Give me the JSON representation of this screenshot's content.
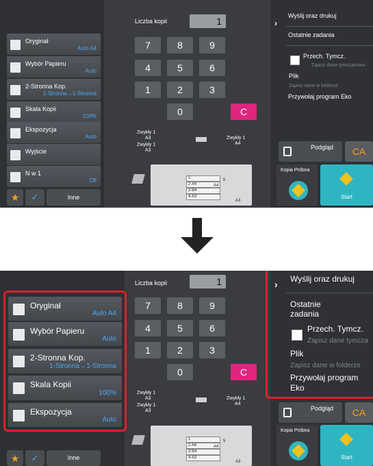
{
  "top_panel": {
    "menu": [
      {
        "label": "Oryginał",
        "value": "Auto A4",
        "icon": "original-icon"
      },
      {
        "label": "Wybór Papieru",
        "value": "Auto",
        "icon": "paper-select-icon"
      },
      {
        "label": "2-Stronna Kop.",
        "value": "1-Stronna→1-Stronna",
        "icon": "duplex-icon"
      },
      {
        "label": "Skala Kopii",
        "value": "100%",
        "icon": "scale-icon"
      },
      {
        "label": "Ekspozycja",
        "value": "Auto",
        "icon": "exposure-icon"
      },
      {
        "label": "Wyjście",
        "value": "",
        "icon": "output-icon"
      },
      {
        "label": "N w 1",
        "value": "Off",
        "icon": "n-in-1-icon"
      }
    ],
    "toolbar": {
      "others_label": "Inne"
    },
    "keypad": {
      "copies_label": "Liczba kopii",
      "copies_value": "1",
      "keys": [
        "7",
        "8",
        "9",
        "4",
        "5",
        "6",
        "1",
        "2",
        "3",
        "0"
      ],
      "clear_label": "C"
    },
    "trays": {
      "tray1": {
        "name": "Zwykły 1",
        "size": "A3"
      },
      "tray2": {
        "name": "Zwykły 1",
        "size": "A3"
      },
      "tray3": {
        "name": "Zwykły 1",
        "size": "A4"
      }
    },
    "copier_trays": [
      {
        "num": "1",
        "size": ""
      },
      {
        "num": "2",
        "size": "A4"
      },
      {
        "num": "3",
        "size": "B4"
      },
      {
        "num": "4",
        "size": "A3"
      }
    ],
    "copier_side": [
      {
        "label": "A4"
      },
      {
        "label": "5"
      },
      {
        "label": "A3"
      }
    ],
    "right": {
      "send_print": "Wyślij oraz drukuj",
      "recent_jobs": "Ostatnie zadania",
      "temp_save": "Przech. Tymcz.",
      "temp_save_sub": "Zapisz dane tymczasowo",
      "file": "Plik",
      "file_sub": "Zapisz dane w folderze",
      "eco": "Przywołaj program Eko",
      "preview": "Podgląd",
      "ca": "CA",
      "proof": "Kopia Próbna",
      "start": "Start"
    }
  },
  "bottom_panel": {
    "menu": [
      {
        "label": "Oryginał",
        "value": "Auto A4",
        "icon": "original-icon"
      },
      {
        "label": "Wybór Papieru",
        "value": "Auto",
        "icon": "paper-select-icon"
      },
      {
        "label": "2-Stronna Kop.",
        "value": "1-Stronna→1-Stronna",
        "icon": "duplex-icon"
      },
      {
        "label": "Skala Kopii",
        "value": "100%",
        "icon": "scale-icon"
      },
      {
        "label": "Ekspozycja",
        "value": "Auto",
        "icon": "exposure-icon"
      }
    ],
    "toolbar": {
      "others_label": "Inne"
    },
    "keypad": {
      "copies_label": "Liczba kopii",
      "copies_value": "1",
      "keys": [
        "7",
        "8",
        "9",
        "4",
        "5",
        "6",
        "1",
        "2",
        "3",
        "0"
      ],
      "clear_label": "C"
    },
    "trays": {
      "tray1": {
        "name": "Zwykły 1",
        "size": "A3"
      },
      "tray2": {
        "name": "Zwykły 1",
        "size": "A3"
      },
      "tray3": {
        "name": "Zwykły 1",
        "size": "A4"
      }
    },
    "copier_trays": [
      {
        "num": "1",
        "size": ""
      },
      {
        "num": "2",
        "size": "A4"
      },
      {
        "num": "3",
        "size": "B4"
      },
      {
        "num": "4",
        "size": "A3"
      }
    ],
    "copier_side": [
      {
        "label": "A4"
      },
      {
        "label": "5"
      },
      {
        "label": "A3"
      }
    ],
    "right": {
      "send_print": "Wyślij oraz drukuj",
      "recent_jobs_1": "Ostatnie",
      "recent_jobs_2": "zadania",
      "temp_save": "Przech. Tymcz.",
      "temp_save_sub": "Zapisz dane tymcza",
      "file": "Plik",
      "file_sub": "Zapisz dane w folderze",
      "eco_1": "Przywołaj program",
      "eco_2": "Eko",
      "preview": "Podgląd",
      "ca": "CA",
      "proof": "Kopia Próbna",
      "start": "Start"
    }
  },
  "colors": {
    "accent_blue": "#4ea8f0",
    "highlight_red": "#d7222b",
    "start_teal": "#2fb5c2",
    "clear_pink": "#e0257f",
    "ca_orange": "#f4a21c"
  }
}
